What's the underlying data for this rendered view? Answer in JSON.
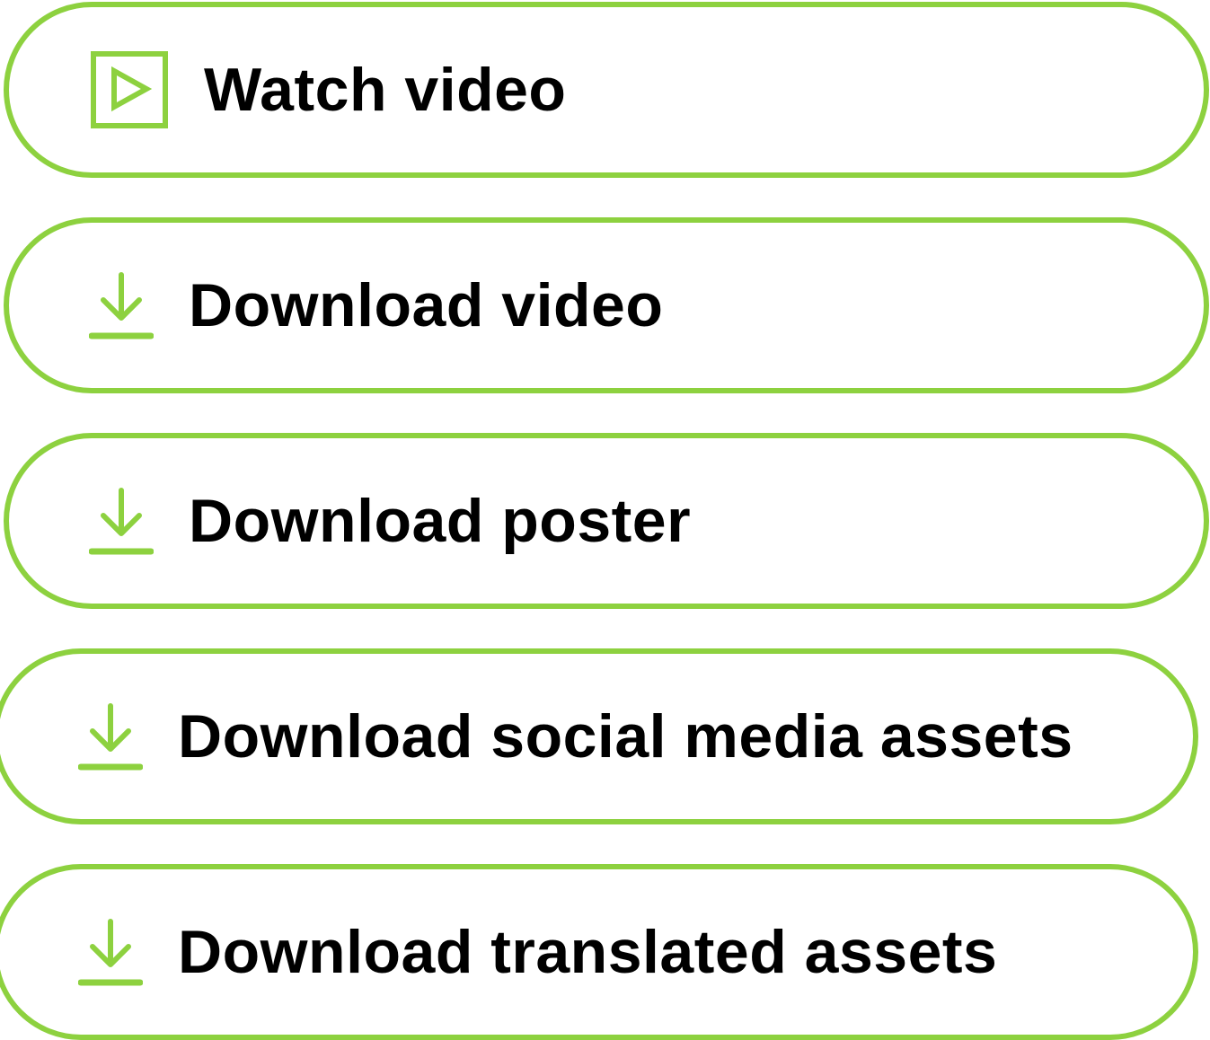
{
  "accent_color": "#8dd13f",
  "text_color": "#000000",
  "buttons": [
    {
      "label": "Watch video",
      "icon": "play-icon"
    },
    {
      "label": "Download video",
      "icon": "download-icon"
    },
    {
      "label": "Download poster",
      "icon": "download-icon"
    },
    {
      "label": "Download social media assets",
      "icon": "download-icon"
    },
    {
      "label": "Download translated assets",
      "icon": "download-icon"
    }
  ]
}
